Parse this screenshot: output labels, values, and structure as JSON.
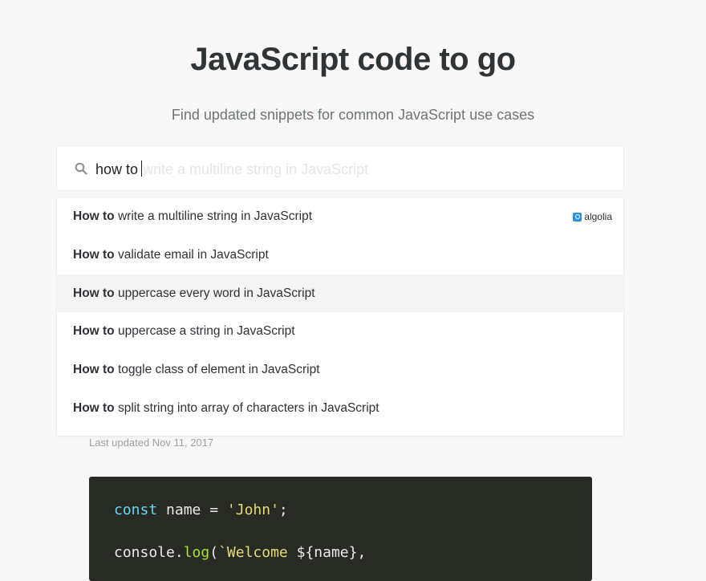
{
  "header": {
    "title": "JavaScript code to go",
    "subtitle": "Find updated snippets for common JavaScript use cases"
  },
  "search": {
    "value": "how to",
    "ghost_completion": "write a multiline string in JavaScript",
    "icon": "search-icon"
  },
  "dropdown": {
    "branding": "algolia",
    "items": [
      {
        "prefix": "How to",
        "rest": " write a multiline string in JavaScript",
        "active": false
      },
      {
        "prefix": "How to",
        "rest": " validate email in JavaScript",
        "active": false
      },
      {
        "prefix": "How to",
        "rest": " uppercase every word in JavaScript",
        "active": true
      },
      {
        "prefix": "How to",
        "rest": " uppercase a string in JavaScript",
        "active": false
      },
      {
        "prefix": "How to",
        "rest": " toggle class of element in JavaScript",
        "active": false
      },
      {
        "prefix": "How to",
        "rest": " split string into array of characters in JavaScript",
        "active": false
      }
    ]
  },
  "article": {
    "last_updated": "Last updated Nov 11, 2017",
    "code": {
      "line1": {
        "kw": "const",
        "a": " name = ",
        "str": "'John'",
        "b": ";"
      },
      "line2": {
        "a": "console.",
        "fn": "log",
        "b": "(",
        "str": "`Welcome ",
        "c": "${name},"
      }
    }
  },
  "colors": {
    "background": "#f8f8f8",
    "code_background": "#282a24",
    "algolia_blue": "#2e91e8",
    "active_row": "#f4f4f4"
  }
}
